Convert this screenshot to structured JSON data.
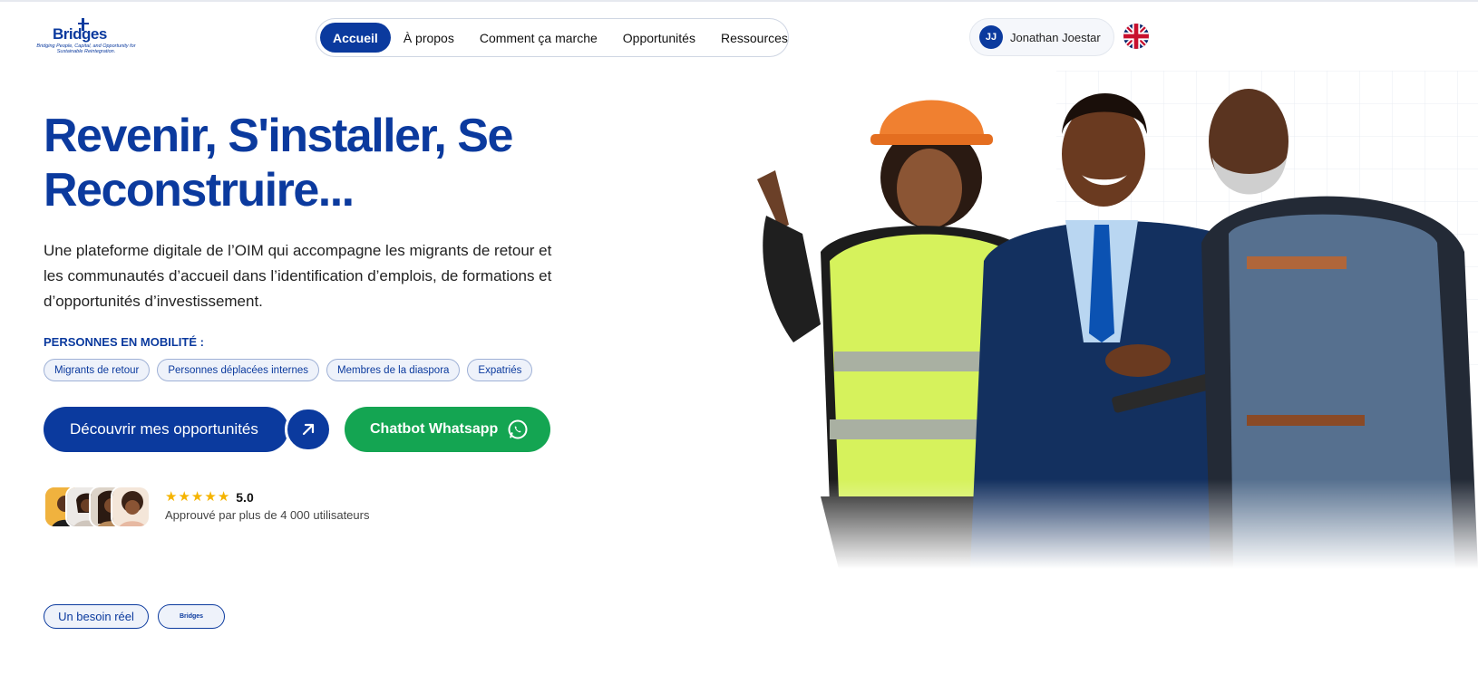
{
  "logo": {
    "word": "Bridges",
    "tagline": "Bridging People, Capital, and Opportunity for Sustainable Reintegration."
  },
  "nav": {
    "items": [
      {
        "label": "Accueil",
        "active": true
      },
      {
        "label": "À propos",
        "active": false
      },
      {
        "label": "Comment ça marche",
        "active": false
      },
      {
        "label": "Opportunités",
        "active": false
      },
      {
        "label": "Ressources",
        "active": false
      }
    ]
  },
  "user": {
    "initials": "JJ",
    "name": "Jonathan Joestar",
    "language_icon": "uk-flag-icon"
  },
  "hero": {
    "title": "Revenir, S'installer, Se Reconstruire...",
    "description": "Une plateforme digitale de l’OIM qui accompagne les migrants de retour et les communautés d’accueil dans l’identification d’emplois, de formations et d’opportunités d’investissement.",
    "mobility_label": "PERSONNES EN MOBILITÉ :",
    "tags": [
      "Migrants de retour",
      "Personnes déplacées internes",
      "Membres de la diaspora",
      "Expatriés"
    ],
    "cta_primary": "Découvrir mes opportunités",
    "cta_secondary": "Chatbot Whatsapp",
    "rating": {
      "stars": 5,
      "score": "5.0",
      "caption": "Approuvé par plus de 4 000 utilisateurs"
    }
  },
  "bottom": {
    "need_label": "Un besoin réel",
    "mini_logo": "Bridges"
  },
  "colors": {
    "brand": "#0b3a9e",
    "whatsapp": "#14a552",
    "star": "#f5b400"
  }
}
